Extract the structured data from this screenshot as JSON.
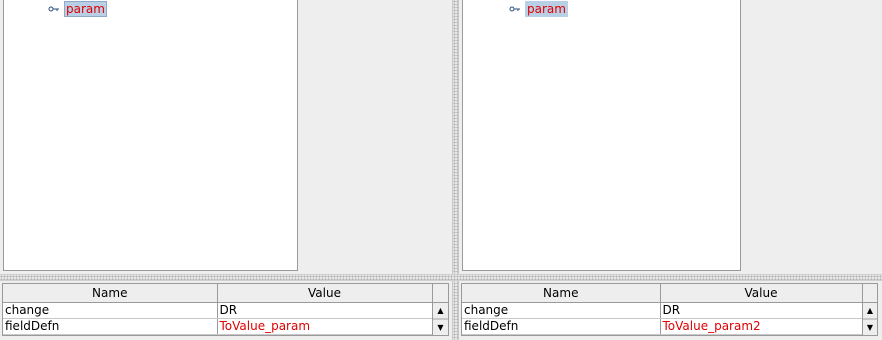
{
  "left_pane": {
    "tree": {
      "node_label": "param",
      "node_icon": "tree-node-handle-icon"
    },
    "table": {
      "headers": [
        "Name",
        "Value"
      ],
      "rows": [
        {
          "name": "change",
          "value": "DR"
        },
        {
          "name": "fieldDefn",
          "value": "ToValue_param"
        }
      ]
    }
  },
  "right_pane": {
    "tree": {
      "node_label": "param",
      "node_icon": "tree-node-handle-icon"
    },
    "table": {
      "headers": [
        "Name",
        "Value"
      ],
      "rows": [
        {
          "name": "change",
          "value": "DR"
        },
        {
          "name": "fieldDefn",
          "value": "ToValue_param2"
        }
      ]
    }
  },
  "scroll": {
    "up_icon": "scroll-up-arrow-icon",
    "down_icon": "scroll-down-arrow-icon",
    "up_glyph": "▲",
    "down_glyph": "▼"
  },
  "colors": {
    "changed_value": "#e00000",
    "selection": "#b8cfe5",
    "panel_bg": "#eeeeee"
  }
}
